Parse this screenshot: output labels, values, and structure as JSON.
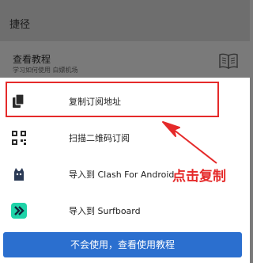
{
  "background": {
    "header_title": "捷径",
    "row_title": "查看教程",
    "row_subtitle": "学习如何使用 白嫖机场"
  },
  "sheet": {
    "items": [
      {
        "label": "复制订阅地址",
        "icon": "copy-icon"
      },
      {
        "label": "扫描二维码订阅",
        "icon": "qr-code-icon"
      },
      {
        "label": "导入到 Clash For Android",
        "icon": "clash-cat-icon"
      },
      {
        "label": "导入到 Surfboard",
        "icon": "surfboard-icon"
      }
    ],
    "cta_label": "不会使用，查看使用教程"
  },
  "annotation": {
    "text": "点击复制",
    "color": "#e52a2a"
  },
  "colors": {
    "primary": "#2b6fcf",
    "surfboard": "#1fd3a8",
    "highlight": "#e52a2a"
  }
}
